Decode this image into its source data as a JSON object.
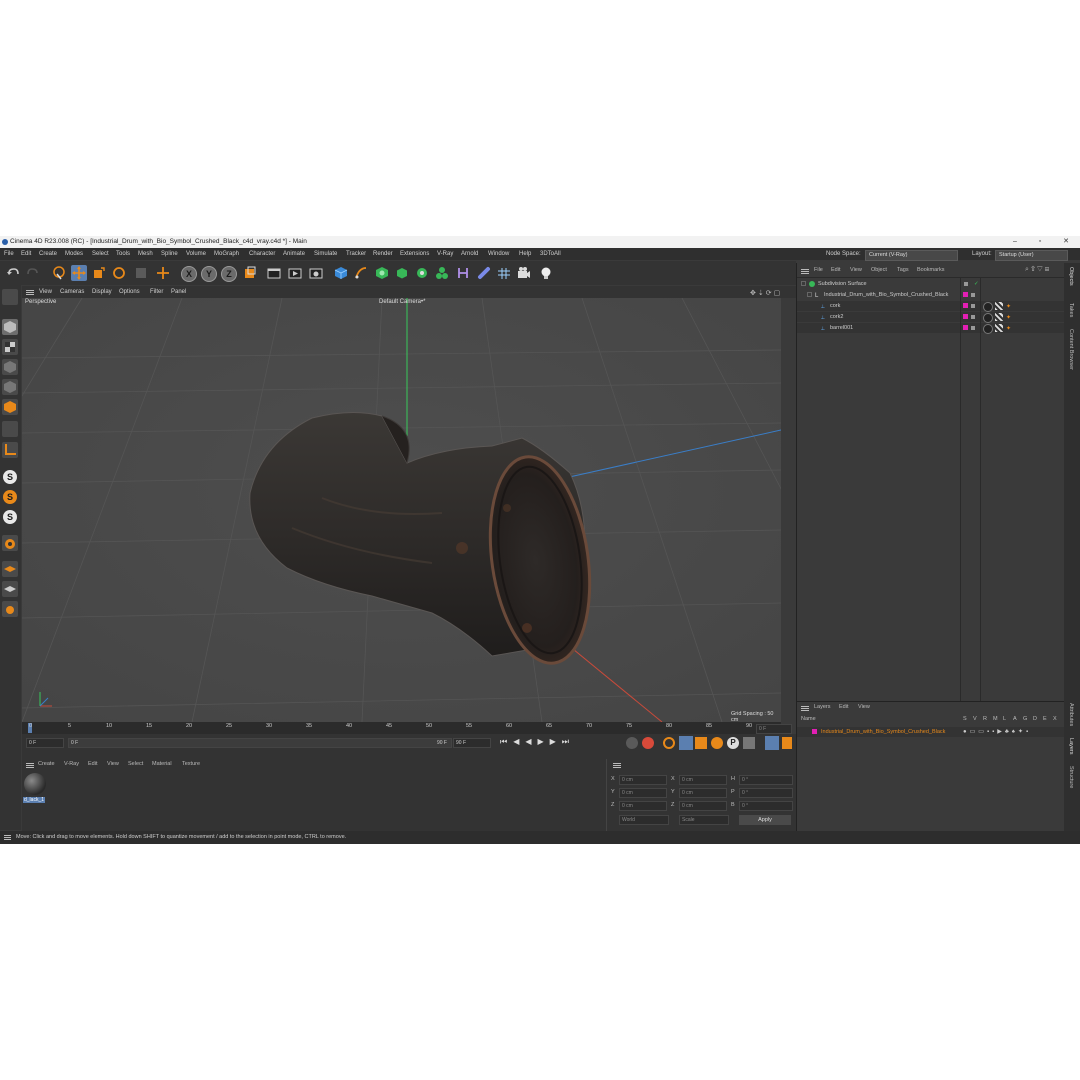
{
  "window": {
    "title": "Cinema 4D R23.008 (RC) - [Industrial_Drum_with_Bio_Symbol_Crushed_Black_c4d_vray.c4d *] - Main",
    "minimize": "–",
    "maximize": "▫",
    "close": "✕"
  },
  "menubar": {
    "items": [
      "File",
      "Edit",
      "Create",
      "Modes",
      "Select",
      "Tools",
      "Mesh",
      "Spline",
      "Volume",
      "MoGraph",
      "Character",
      "Animate",
      "Simulate",
      "Tracker",
      "Render",
      "Extensions",
      "V-Ray",
      "Arnold",
      "Window",
      "Help",
      "3DToAll"
    ],
    "node_space_label": "Node Space:",
    "node_space_value": "Current (V-Ray)",
    "layout_label": "Layout:",
    "layout_value": "Startup (User)"
  },
  "toolbar": {
    "axis_x": "X",
    "axis_y": "Y",
    "axis_z": "Z"
  },
  "leftbar": {
    "s1": "S",
    "s2": "S",
    "s3": "S"
  },
  "viewport": {
    "menu": [
      "View",
      "Cameras",
      "Display",
      "Options",
      "Filter",
      "Panel"
    ],
    "view_name": "Perspective",
    "camera": "Default Camera•*",
    "grid_spacing": "Grid Spacing : 50 cm"
  },
  "timeline": {
    "ticks": [
      "0",
      "5",
      "10",
      "15",
      "20",
      "25",
      "30",
      "35",
      "40",
      "45",
      "50",
      "55",
      "60",
      "65",
      "70",
      "75",
      "80",
      "85",
      "90"
    ],
    "current_frame_right": "0 F",
    "start_frame": "0 F",
    "slider_start": "0 F",
    "slider_end": "90 F",
    "end_frame": "90 F"
  },
  "material_panel": {
    "menu": [
      "Create",
      "V-Ray",
      "Edit",
      "View",
      "Select",
      "Material",
      "Texture"
    ],
    "material_name": "d_lack_1"
  },
  "coords": {
    "rows": [
      {
        "a": "X",
        "av": "0 cm",
        "b": "X",
        "bv": "0 cm",
        "c": "H",
        "cv": "0 °"
      },
      {
        "a": "Y",
        "av": "0 cm",
        "b": "Y",
        "bv": "0 cm",
        "c": "P",
        "cv": "0 °"
      },
      {
        "a": "Z",
        "av": "0 cm",
        "b": "Z",
        "bv": "0 cm",
        "c": "B",
        "cv": "0 °"
      }
    ],
    "mode1": "World",
    "mode2": "Scale",
    "apply": "Apply"
  },
  "status": {
    "text": "Move: Click and drag to move elements. Hold down SHIFT to quantize movement / add to the selection in point mode, CTRL to remove."
  },
  "objects": {
    "menu": [
      "File",
      "Edit",
      "View",
      "Object",
      "Tags",
      "Bookmarks"
    ],
    "items": [
      {
        "name": "Subdivision Surface"
      },
      {
        "name": "Industrial_Drum_with_Bio_Symbol_Crushed_Black"
      },
      {
        "name": "cork"
      },
      {
        "name": "cork2"
      },
      {
        "name": "barrel001"
      }
    ]
  },
  "layers": {
    "menu": [
      "Layers",
      "Edit",
      "View"
    ],
    "col_name": "Name",
    "cols": [
      "S",
      "V",
      "R",
      "M",
      "L",
      "A",
      "G",
      "D",
      "E",
      "X"
    ],
    "layer_name": "Industrial_Drum_with_Bio_Symbol_Crushed_Black"
  },
  "right_tabs": {
    "top": [
      "Objects",
      "Takes",
      "Content Browser"
    ],
    "bottom": [
      "Attributes",
      "Layers",
      "Structure"
    ]
  },
  "colors": {
    "accent_blue": "#5b7fb0",
    "orange": "#e8891a",
    "layer_pink": "#e21fb4",
    "y_axis": "#38c85a",
    "x_axis": "#c84a3a",
    "z_axis": "#3a7ec8"
  }
}
